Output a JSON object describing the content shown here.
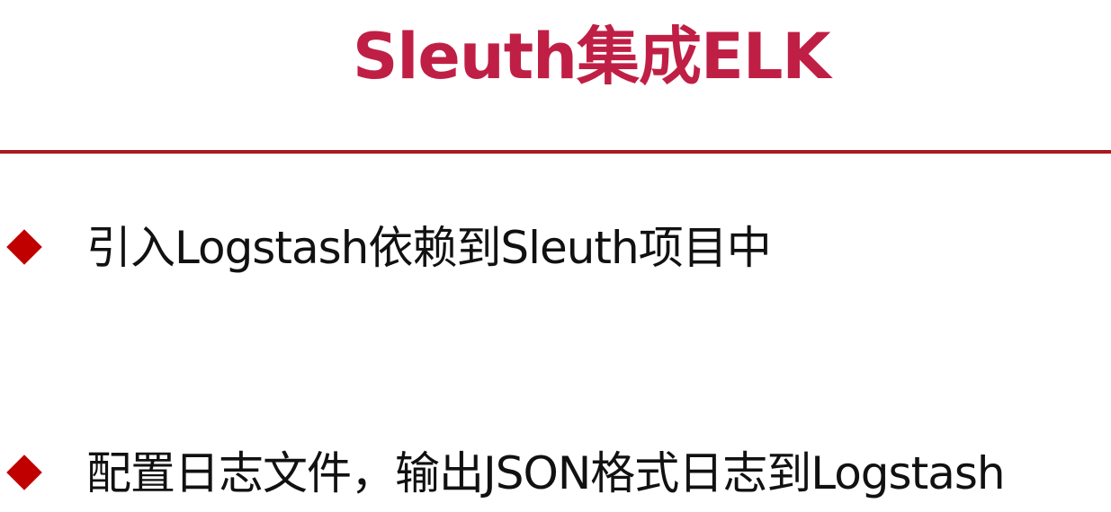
{
  "slide": {
    "title": "Sleuth集成ELK",
    "bullets": [
      {
        "text": "引入Logstash依赖到Sleuth项目中"
      },
      {
        "text": "配置日志文件，输出JSON格式日志到Logstash"
      }
    ],
    "colors": {
      "title": "#c01f45",
      "rule": "#a61b1f",
      "bullet": "#c00000",
      "text": "#111111"
    },
    "icons": {
      "bullet": "diamond-bullet-icon"
    }
  }
}
